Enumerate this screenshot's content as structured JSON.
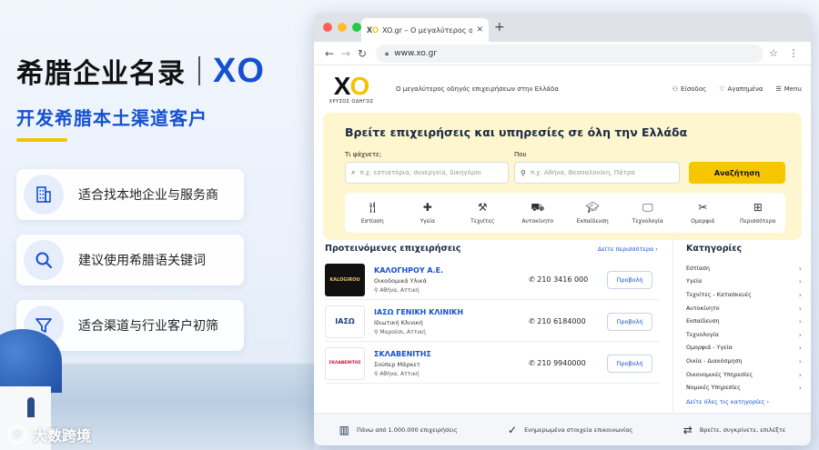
{
  "promo": {
    "title_cn": "希腊企业名录",
    "title_brand": "XO",
    "subtitle": "开发希腊本土渠道客户",
    "features": [
      {
        "label": "适合找本地企业与服务商",
        "icon": "building-icon"
      },
      {
        "label": "建议使用希腊语关键词",
        "icon": "search-icon"
      },
      {
        "label": "适合渠道与行业客户初筛",
        "icon": "filter-icon"
      }
    ],
    "watermark": "大数跨境"
  },
  "browser": {
    "tab_title": "XO.gr – Ο μεγαλύτερος οδηγός επιχειρήσεων",
    "url": "www.xo.gr"
  },
  "site": {
    "logo_text": "XO",
    "logo_sub": "ΧΡΥΣΟΣ ΟΔΗΓΟΣ",
    "tagline": "Ο μεγαλύτερος οδηγός επιχειρήσεων στην Ελλάδα",
    "header_links": {
      "login": "Είσοδος",
      "favorites": "Αγαπημένα",
      "menu": "Menu"
    },
    "hero": {
      "title": "Βρείτε επιχειρήσεις και υπηρεσίες σε όλη την Ελλάδα",
      "what_label": "Τι ψάχνετε;",
      "what_placeholder": "π.χ. εστιατόρια, συνεργεία, δικηγόροι",
      "where_label": "Που",
      "where_placeholder": "π.χ. Αθήνα, Θεσσαλονίκη, Πάτρα",
      "search_button": "Αναζήτηση"
    },
    "categories": [
      {
        "label": "Εστίαση",
        "icon": "utensils-icon"
      },
      {
        "label": "Υγεία",
        "icon": "health-cross-icon"
      },
      {
        "label": "Τεχνίτες",
        "icon": "tools-icon"
      },
      {
        "label": "Αυτοκίνητο",
        "icon": "car-icon"
      },
      {
        "label": "Εκπαίδευση",
        "icon": "graduation-cap-icon"
      },
      {
        "label": "Τεχνολογία",
        "icon": "monitor-icon"
      },
      {
        "label": "Ομορφιά",
        "icon": "scissors-icon"
      },
      {
        "label": "Περισσότερα",
        "icon": "grid-icon"
      }
    ],
    "recommended": {
      "title": "Προτεινόμενες επιχειρήσεις",
      "more": "Δείτε περισσότερα ›",
      "view_label": "Προβολή",
      "items": [
        {
          "thumb": "KALOGIROU",
          "name": "ΚΑΛΟΓΗΡΟΥ Α.Ε.",
          "kind": "Οικοδομικά Υλικά",
          "location": "Αθήνα, Αττική",
          "phone": "210 3416 000"
        },
        {
          "thumb": "ΙΑΣΩ",
          "name": "ΙΑΣΩ ΓΕΝΙΚΗ ΚΛΙΝΙΚΗ",
          "kind": "Ιδιωτική Κλινική",
          "location": "Μαρούσι, Αττική",
          "phone": "210 6184000"
        },
        {
          "thumb": "ΣΚΛΑΒΕΝΙΤΗΣ",
          "name": "ΣΚΛΑΒΕΝΙΤΗΣ",
          "kind": "Σούπερ Μάρκετ",
          "location": "Αθήνα, Αττική",
          "phone": "210 9940000"
        }
      ]
    },
    "sidebar": {
      "title": "Κατηγορίες",
      "items": [
        "Εστίαση",
        "Υγεία",
        "Τεχνίτες - Κατασκευές",
        "Αυτοκίνητο",
        "Εκπαίδευση",
        "Τεχνολογία",
        "Ομορφιά - Υγεία",
        "Οικία - Διακόσμηση",
        "Οικονομικές Υπηρεσίες",
        "Νομικές Υπηρεσίες"
      ],
      "all_link": "Δείτε όλες τις κατηγορίες ›"
    },
    "footer": [
      {
        "text": "Πάνω από 1.000.000 επιχειρήσεις",
        "icon": "building-icon"
      },
      {
        "text": "Ενημερωμένα στοιχεία επικοινωνίας",
        "icon": "check-circle-icon"
      },
      {
        "text": "Βρείτε, συγκρίνετε, επιλέξτε",
        "icon": "swap-arrows-icon"
      }
    ]
  },
  "colors": {
    "brand_blue": "#1550d0",
    "brand_yellow": "#f2c400",
    "hero_bg": "#fdf6cf"
  }
}
